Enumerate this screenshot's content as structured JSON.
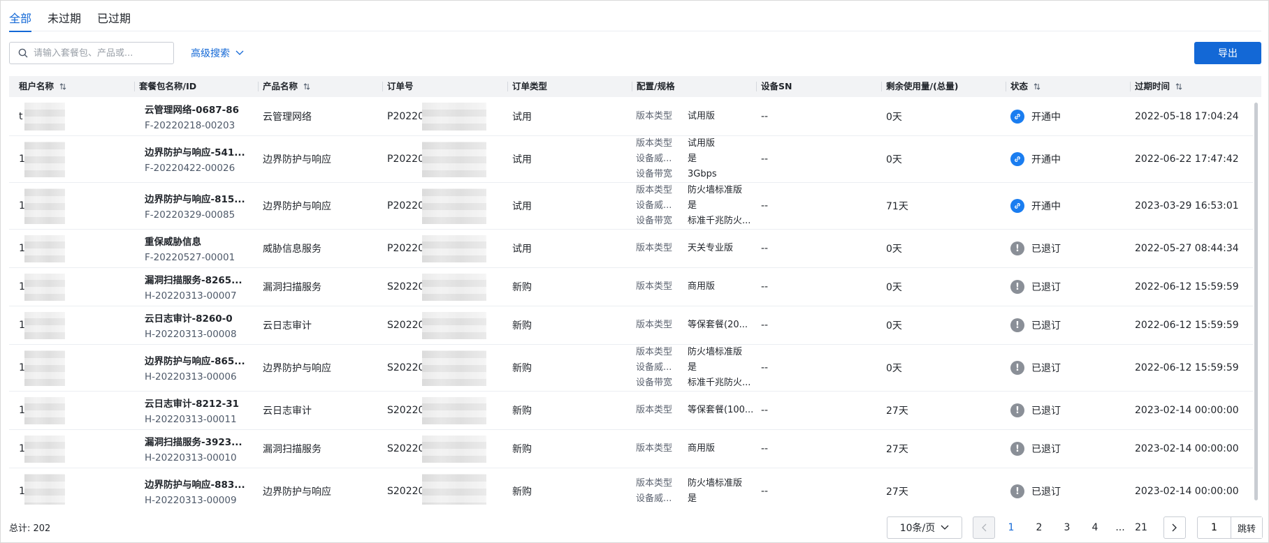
{
  "tabs": [
    {
      "label": "全部",
      "active": true
    },
    {
      "label": "未过期",
      "active": false
    },
    {
      "label": "已过期",
      "active": false
    }
  ],
  "toolbar": {
    "search_placeholder": "请输入套餐包、产品或...",
    "advanced_search": "高级搜索",
    "export_label": "导出"
  },
  "table": {
    "columns": [
      {
        "key": "tenant",
        "label": "租户名称",
        "sortable": true
      },
      {
        "key": "package",
        "label": "套餐包名称/ID",
        "sortable": false
      },
      {
        "key": "product",
        "label": "产品名称",
        "sortable": true
      },
      {
        "key": "order",
        "label": "订单号",
        "sortable": false
      },
      {
        "key": "order_type",
        "label": "订单类型",
        "sortable": false
      },
      {
        "key": "config",
        "label": "配置/规格",
        "sortable": false
      },
      {
        "key": "sn",
        "label": "设备SN",
        "sortable": false
      },
      {
        "key": "remaining",
        "label": "剩余使用量/(总量)",
        "sortable": false
      },
      {
        "key": "status",
        "label": "状态",
        "sortable": true
      },
      {
        "key": "expire",
        "label": "过期时间",
        "sortable": true
      }
    ],
    "rows": [
      {
        "tenant": "t",
        "package_name": "云管理网络-0687-86",
        "package_id": "F-20220218-00203",
        "product": "云管理网络",
        "order": "P202202",
        "order_type": "试用",
        "config": [
          {
            "label": "版本类型",
            "value": "试用版"
          }
        ],
        "sn": "--",
        "remaining": "0天",
        "status": "开通中",
        "status_type": "ok",
        "expire": "2022-05-18 17:04:24"
      },
      {
        "tenant": "1",
        "package_name": "边界防护与响应-541...",
        "package_id": "F-20220422-00026",
        "product": "边界防护与响应",
        "order": "P202204",
        "order_type": "试用",
        "config": [
          {
            "label": "版本类型",
            "value": "试用版"
          },
          {
            "label": "设备威...",
            "value": "是"
          },
          {
            "label": "设备带宽",
            "value": "3Gbps"
          }
        ],
        "sn": "--",
        "remaining": "0天",
        "status": "开通中",
        "status_type": "ok",
        "expire": "2022-06-22 17:47:42"
      },
      {
        "tenant": "1",
        "package_name": "边界防护与响应-815...",
        "package_id": "F-20220329-00085",
        "product": "边界防护与响应",
        "order": "P202203",
        "order_type": "试用",
        "config": [
          {
            "label": "版本类型",
            "value": "防火墙标准版"
          },
          {
            "label": "设备威...",
            "value": "是"
          },
          {
            "label": "设备带宽",
            "value": "标准千兆防火..."
          }
        ],
        "sn": "--",
        "remaining": "71天",
        "status": "开通中",
        "status_type": "ok",
        "expire": "2023-03-29 16:53:01"
      },
      {
        "tenant": "1",
        "package_name": "重保威胁信息",
        "package_id": "F-20220527-00001",
        "product": "威胁信息服务",
        "order": "P202205",
        "order_type": "试用",
        "config": [
          {
            "label": "版本类型",
            "value": "天关专业版"
          }
        ],
        "sn": "--",
        "remaining": "0天",
        "status": "已退订",
        "status_type": "off",
        "expire": "2022-05-27 08:44:34"
      },
      {
        "tenant": "1",
        "package_name": "漏洞扫描服务-8265...",
        "package_id": "H-20220313-00007",
        "product": "漏洞扫描服务",
        "order": "S202203",
        "order_type": "新购",
        "config": [
          {
            "label": "版本类型",
            "value": "商用版"
          }
        ],
        "sn": "--",
        "remaining": "0天",
        "status": "已退订",
        "status_type": "off",
        "expire": "2022-06-12 15:59:59"
      },
      {
        "tenant": "1",
        "package_name": "云日志审计-8260-0",
        "package_id": "H-20220313-00008",
        "product": "云日志审计",
        "order": "S202203",
        "order_type": "新购",
        "config": [
          {
            "label": "版本类型",
            "value": "等保套餐(20..."
          }
        ],
        "sn": "--",
        "remaining": "0天",
        "status": "已退订",
        "status_type": "off",
        "expire": "2022-06-12 15:59:59"
      },
      {
        "tenant": "1",
        "package_name": "边界防护与响应-865...",
        "package_id": "H-20220313-00006",
        "product": "边界防护与响应",
        "order": "S202203",
        "order_type": "新购",
        "config": [
          {
            "label": "版本类型",
            "value": "防火墙标准版"
          },
          {
            "label": "设备威...",
            "value": "是"
          },
          {
            "label": "设备带宽",
            "value": "标准千兆防火..."
          }
        ],
        "sn": "--",
        "remaining": "0天",
        "status": "已退订",
        "status_type": "off",
        "expire": "2022-06-12 15:59:59"
      },
      {
        "tenant": "1",
        "package_name": "云日志审计-8212-31",
        "package_id": "H-20220313-00011",
        "product": "云日志审计",
        "order": "S202203",
        "order_type": "新购",
        "config": [
          {
            "label": "版本类型",
            "value": "等保套餐(100..."
          }
        ],
        "sn": "--",
        "remaining": "27天",
        "status": "已退订",
        "status_type": "off",
        "expire": "2023-02-14 00:00:00"
      },
      {
        "tenant": "1",
        "package_name": "漏洞扫描服务-3923...",
        "package_id": "H-20220313-00010",
        "product": "漏洞扫描服务",
        "order": "S202203",
        "order_type": "新购",
        "config": [
          {
            "label": "版本类型",
            "value": "商用版"
          }
        ],
        "sn": "--",
        "remaining": "27天",
        "status": "已退订",
        "status_type": "off",
        "expire": "2023-02-14 00:00:00"
      },
      {
        "tenant": "1",
        "package_name": "边界防护与响应-883...",
        "package_id": "H-20220313-00009",
        "product": "边界防护与响应",
        "order": "S202203",
        "order_type": "新购",
        "config": [
          {
            "label": "版本类型",
            "value": "防火墙标准版"
          },
          {
            "label": "设备威...",
            "value": "是"
          }
        ],
        "sn": "--",
        "remaining": "27天",
        "status": "已退订",
        "status_type": "off",
        "expire": "2023-02-14 00:00:00"
      }
    ]
  },
  "footer": {
    "total": "总计: 202",
    "page_size": "10条/页",
    "pages": [
      "1",
      "2",
      "3",
      "4",
      "...",
      "21"
    ],
    "current_page": "1",
    "jump_value": "1",
    "jump_label": "跳转"
  },
  "colors": {
    "accent": "#1368d6",
    "status_ok": "#1a7df0",
    "status_off": "#8a8f97"
  }
}
